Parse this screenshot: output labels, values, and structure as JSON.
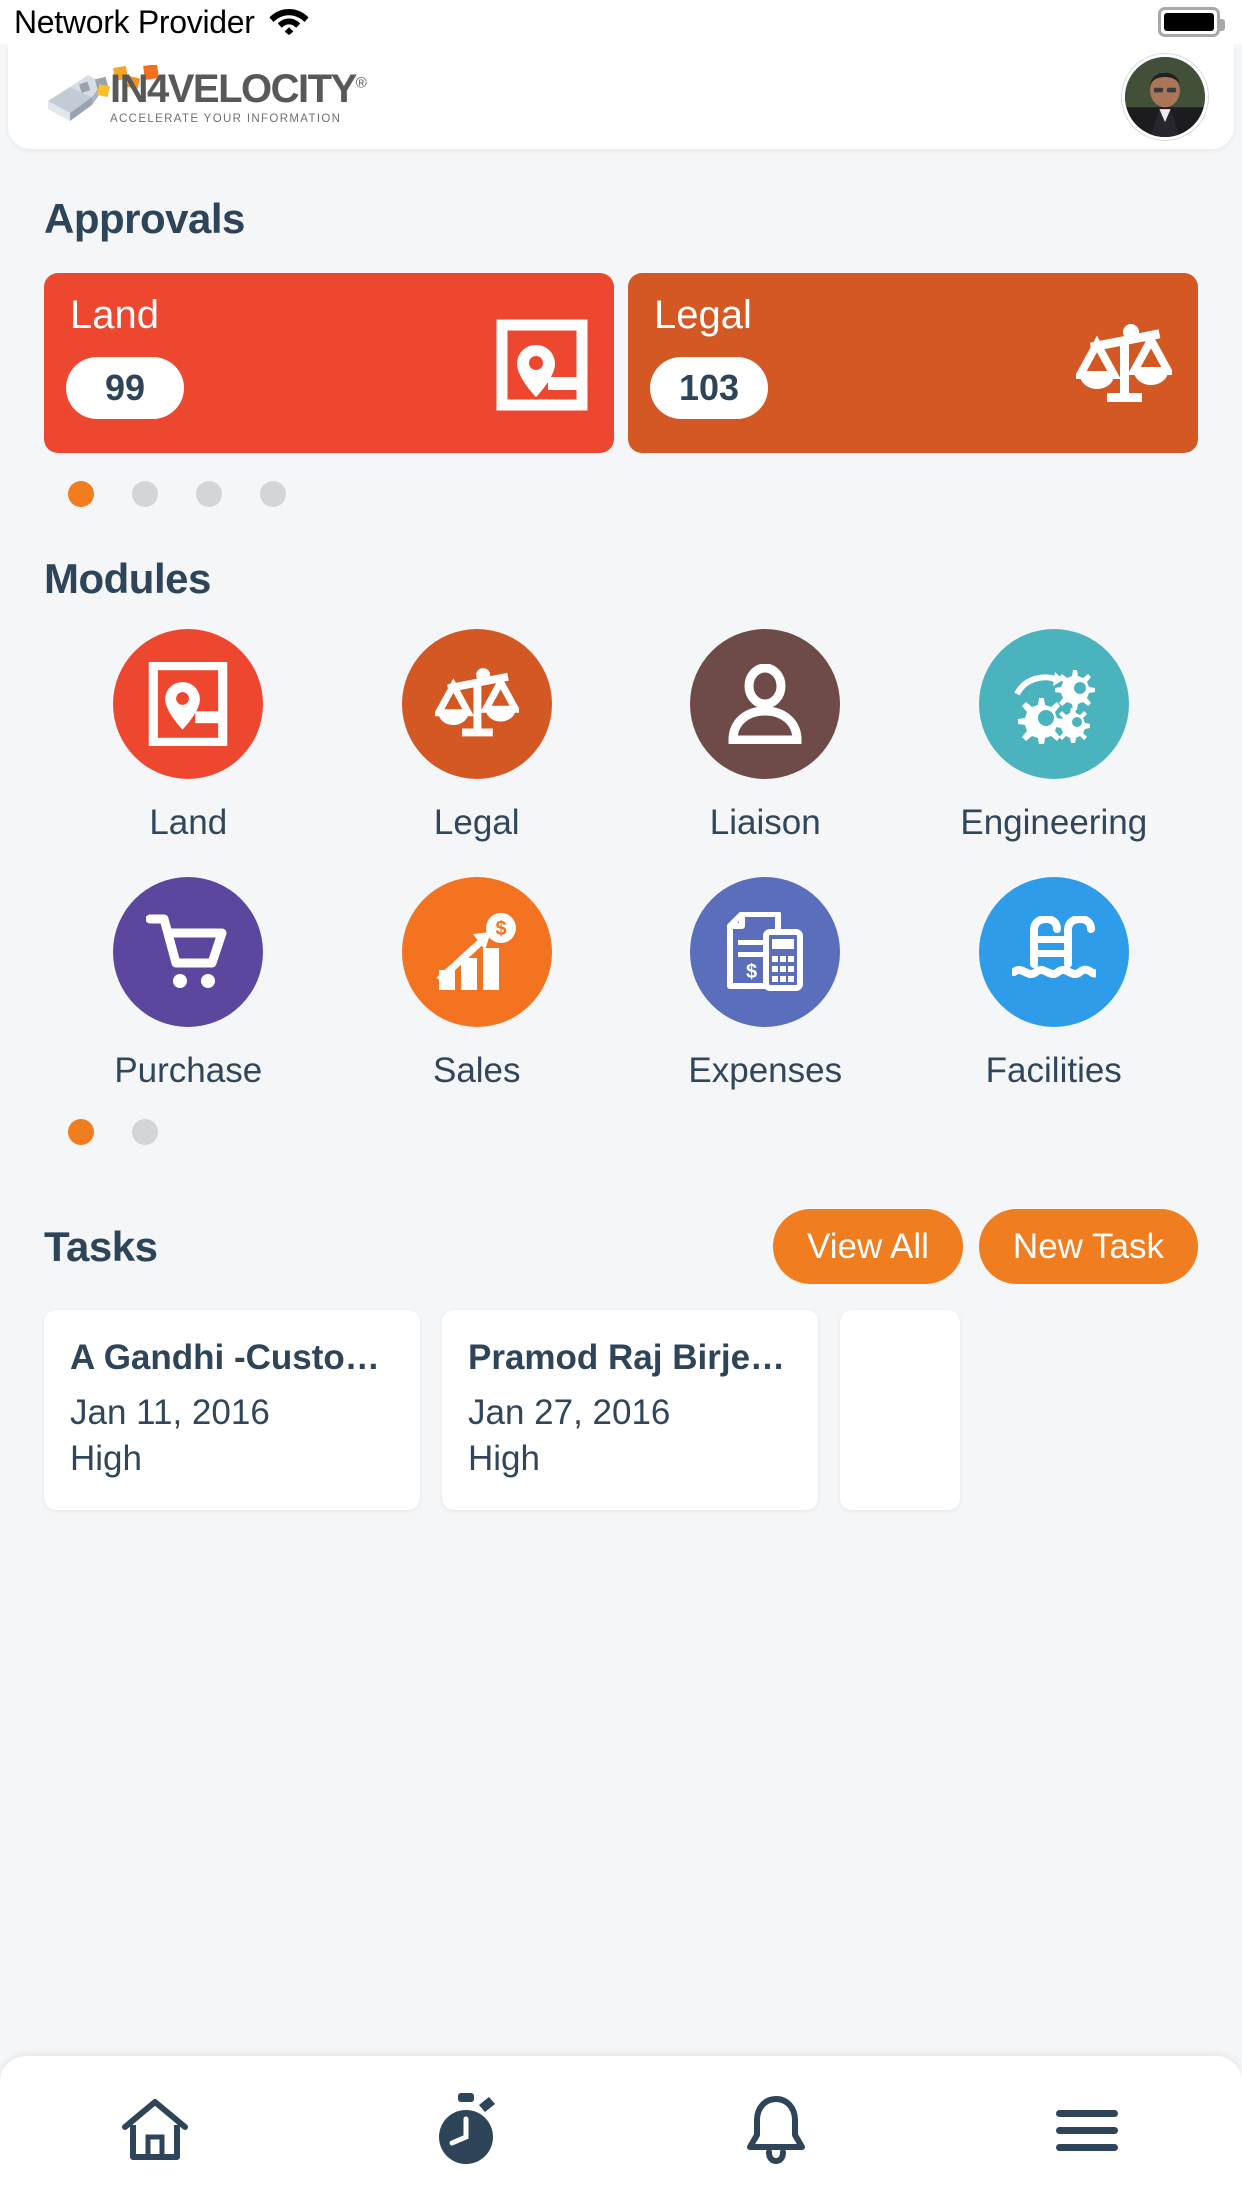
{
  "status_bar": {
    "carrier": "Network Provider",
    "wifi_icon": "wifi-icon",
    "battery_icon": "battery-full-icon"
  },
  "header": {
    "logo_word_part1": "IN",
    "logo_word_part2": "4",
    "logo_word_part3": "VELOCITY",
    "logo_registered": "®",
    "logo_tagline": "ACCELERATE YOUR INFORMATION",
    "avatar_name": "profile-avatar"
  },
  "approvals": {
    "title": "Approvals",
    "cards": [
      {
        "label": "Land",
        "count": "99",
        "color": "#ee4730",
        "icon": "land-map-marker-icon"
      },
      {
        "label": "Legal",
        "count": "103",
        "color": "#d35823",
        "icon": "scales-of-justice-icon"
      }
    ],
    "pager": {
      "total": 4,
      "active": 0,
      "active_color": "#f07d20",
      "inactive_color": "#d3d5d8"
    }
  },
  "modules": {
    "title": "Modules",
    "items": [
      {
        "label": "Land",
        "color": "#ee4730",
        "icon": "land-map-marker-icon"
      },
      {
        "label": "Legal",
        "color": "#d35823",
        "icon": "scales-of-justice-icon"
      },
      {
        "label": "Liaison",
        "color": "#6e4a49",
        "icon": "person-icon"
      },
      {
        "label": "Engineering",
        "color": "#4bb3bd",
        "icon": "gears-icon"
      },
      {
        "label": "Purchase",
        "color": "#5b479d",
        "icon": "shopping-cart-icon"
      },
      {
        "label": "Sales",
        "color": "#f37321",
        "icon": "growth-chart-dollar-icon"
      },
      {
        "label": "Expenses",
        "color": "#5a6ebc",
        "icon": "invoice-calculator-icon"
      },
      {
        "label": "Facilities",
        "color": "#2e9ce8",
        "icon": "swimming-pool-icon"
      }
    ],
    "pager": {
      "total": 2,
      "active": 0,
      "active_color": "#f07d20",
      "inactive_color": "#d3d5d8"
    }
  },
  "tasks": {
    "title": "Tasks",
    "view_all_label": "View All",
    "new_task_label": "New Task",
    "items": [
      {
        "title": "A Gandhi -Custome…",
        "date": "Jan 11, 2016",
        "priority": "High"
      },
      {
        "title": "Pramod Raj Birje-C…",
        "date": "Jan 27, 2016",
        "priority": "High"
      }
    ]
  },
  "bottom_nav": {
    "items": [
      {
        "name": "home-icon",
        "active": false
      },
      {
        "name": "stopwatch-icon",
        "active": true
      },
      {
        "name": "bell-icon",
        "active": false
      },
      {
        "name": "hamburger-menu-icon",
        "active": false
      }
    ],
    "icon_color": "#2e4459"
  }
}
